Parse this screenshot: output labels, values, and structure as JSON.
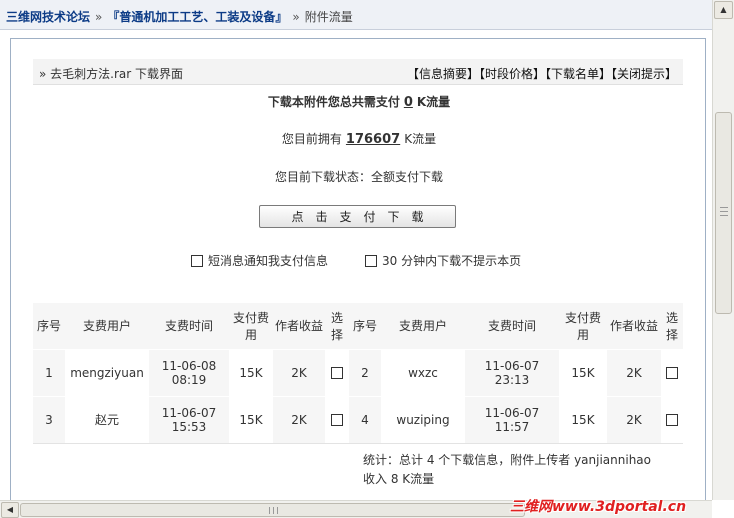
{
  "breadcrumb": {
    "forum": "三维网技术论坛",
    "board": "『普通机加工工艺、工装及设备』",
    "current": "附件流量",
    "separator": "»"
  },
  "download_bar": {
    "file_label": "» 去毛刺方法.rar 下载界面",
    "links": [
      "【信息摘要】",
      "【时段价格】",
      "【下载名单】",
      "【关闭提示】"
    ]
  },
  "payment": {
    "need_prefix": "下载本附件您总共需支付",
    "need_value": "0",
    "need_suffix": "K流量",
    "own_prefix": "您目前拥有",
    "own_value": "176607",
    "own_suffix": "K流量",
    "status": "您目前下载状态：全额支付下载",
    "button_label": "点击支付下载"
  },
  "options": {
    "notify": "短消息通知我支付信息",
    "no_prompt": "30 分钟内下载不提示本页"
  },
  "table": {
    "headers": [
      "序号",
      "支费用户",
      "支费时间",
      "支付费用",
      "作者收益",
      "选择",
      "序号",
      "支费用户",
      "支费时间",
      "支付费用",
      "作者收益",
      "选择"
    ],
    "rows": [
      {
        "left": {
          "no": "1",
          "user": "mengziyuan",
          "date": "11-06-08",
          "time": "08:19",
          "fee": "15K",
          "income": "2K"
        },
        "right": {
          "no": "2",
          "user": "wxzc",
          "date": "11-06-07",
          "time": "23:13",
          "fee": "15K",
          "income": "2K"
        }
      },
      {
        "left": {
          "no": "3",
          "user": "赵元",
          "date": "11-06-07",
          "time": "15:53",
          "fee": "15K",
          "income": "2K"
        },
        "right": {
          "no": "4",
          "user": "wuziping",
          "date": "11-06-07",
          "time": "11:57",
          "fee": "15K",
          "income": "2K"
        }
      }
    ]
  },
  "stats": {
    "line1": "统计：总计 4 个下载信息，附件上传者 yanjiannihao",
    "line2": "收入 8 K流量"
  },
  "watermark": "三维网www.3dportal.cn"
}
